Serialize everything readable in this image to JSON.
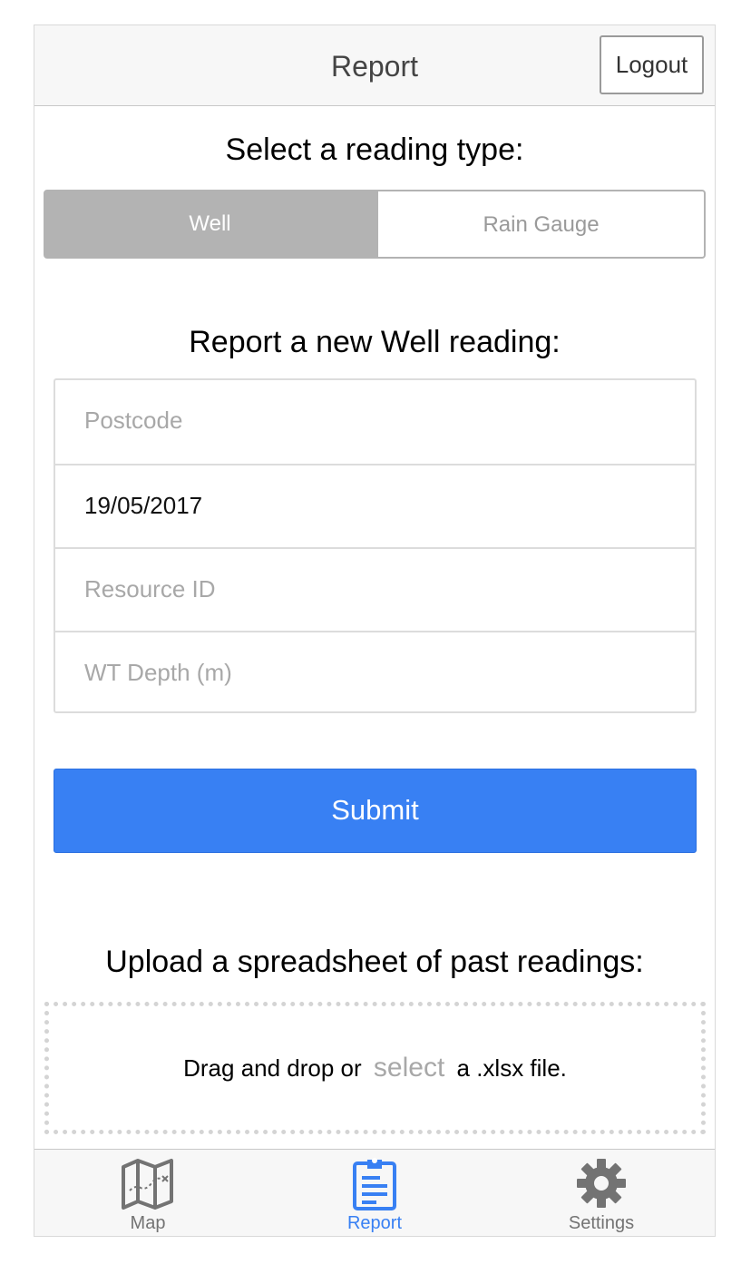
{
  "header": {
    "title": "Report",
    "logout_label": "Logout"
  },
  "reading_type": {
    "heading": "Select a reading type:",
    "options": [
      "Well",
      "Rain Gauge"
    ],
    "selected": "Well"
  },
  "form": {
    "heading": "Report a new Well reading:",
    "fields": {
      "postcode": {
        "placeholder": "Postcode",
        "value": ""
      },
      "date": {
        "placeholder": "",
        "value": "19/05/2017"
      },
      "resource_id": {
        "placeholder": "Resource ID",
        "value": ""
      },
      "wt_depth": {
        "placeholder": "WT Depth (m)",
        "value": ""
      }
    },
    "submit_label": "Submit"
  },
  "upload": {
    "heading": "Upload a spreadsheet of past readings:",
    "text_before": "Drag and drop or",
    "link_label": "select",
    "text_after": "a .xlsx file."
  },
  "tabbar": {
    "active": "Report",
    "tabs": [
      {
        "label": "Map",
        "icon": "map-icon"
      },
      {
        "label": "Report",
        "icon": "clipboard-icon"
      },
      {
        "label": "Settings",
        "icon": "gear-icon"
      }
    ]
  },
  "colors": {
    "accent": "#3880f3",
    "segment_selected": "#b3b3b3",
    "header_bg": "#f7f7f7"
  }
}
